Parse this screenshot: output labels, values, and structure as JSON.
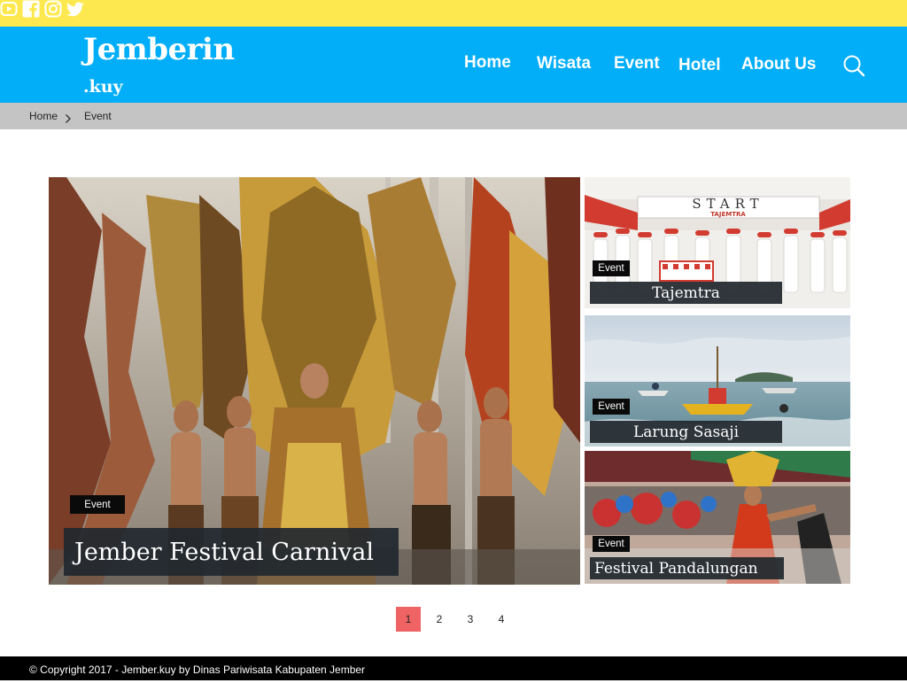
{
  "social": {
    "icons": [
      "youtube-icon",
      "facebook-icon",
      "instagram-icon",
      "twitter-icon"
    ]
  },
  "brand": {
    "name": "Jemberin",
    "suffix": ".kuy"
  },
  "nav": {
    "items": [
      "Home",
      "Wisata",
      "Event",
      "Hotel",
      "About Us"
    ]
  },
  "breadcrumb": {
    "home": "Home",
    "current": "Event"
  },
  "featured": {
    "tag": "Event",
    "title": "Jember Festival Carnival"
  },
  "side_cards": [
    {
      "tag": "Event",
      "title": "Tajemtra",
      "banner_text": "START",
      "banner_sub": "TAJEMTRA"
    },
    {
      "tag": "Event",
      "title": "Larung Sasaji"
    },
    {
      "tag": "Event",
      "title": "Festival Pandalungan"
    }
  ],
  "pagination": {
    "pages": [
      "1",
      "2",
      "3",
      "4"
    ],
    "current": "1"
  },
  "footer": {
    "text": "© Copyright 2017 - Jember.kuy by Dinas Pariwisata Kabupaten Jember"
  },
  "colors": {
    "topbar": "#fde94f",
    "header": "#02aef8",
    "breadcrumb_bar": "#c4c4c4",
    "active_page": "#ef6364",
    "footer": "#000000"
  }
}
